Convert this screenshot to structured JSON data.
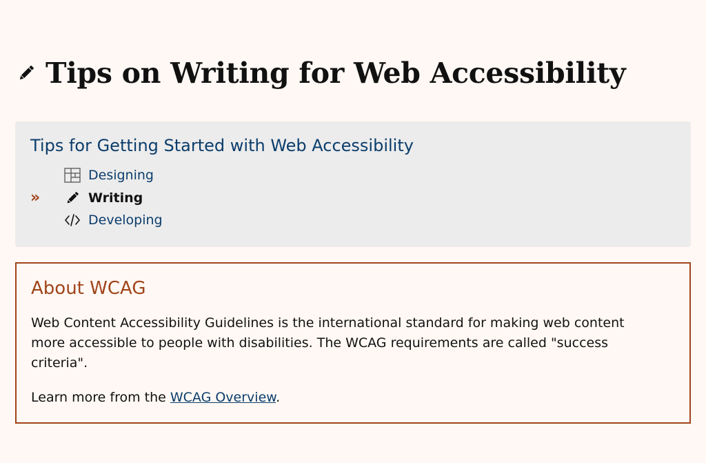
{
  "page": {
    "title": "Tips on Writing for Web Accessibility",
    "title_icon": "pencil-icon"
  },
  "tips_nav": {
    "heading": "Tips for Getting Started with Web Accessibility",
    "current_marker": "»",
    "items": [
      {
        "label": "Designing",
        "icon": "layout-grid-icon",
        "current": false
      },
      {
        "label": "Writing",
        "icon": "pencil-icon",
        "current": true
      },
      {
        "label": "Developing",
        "icon": "code-icon",
        "current": false
      }
    ]
  },
  "about": {
    "heading": "About WCAG",
    "description": "Web Content Accessibility Guidelines is the international standard for making web content more accessible to people with disabilities. The WCAG requirements are called \"success criteria\".",
    "learn_more_prefix": "Learn more from the ",
    "learn_more_link": "WCAG Overview",
    "learn_more_suffix": "."
  },
  "colors": {
    "background": "#fff8f4",
    "nav_box": "#ececec",
    "link": "#0b3d6b",
    "accent": "#a0441a"
  }
}
